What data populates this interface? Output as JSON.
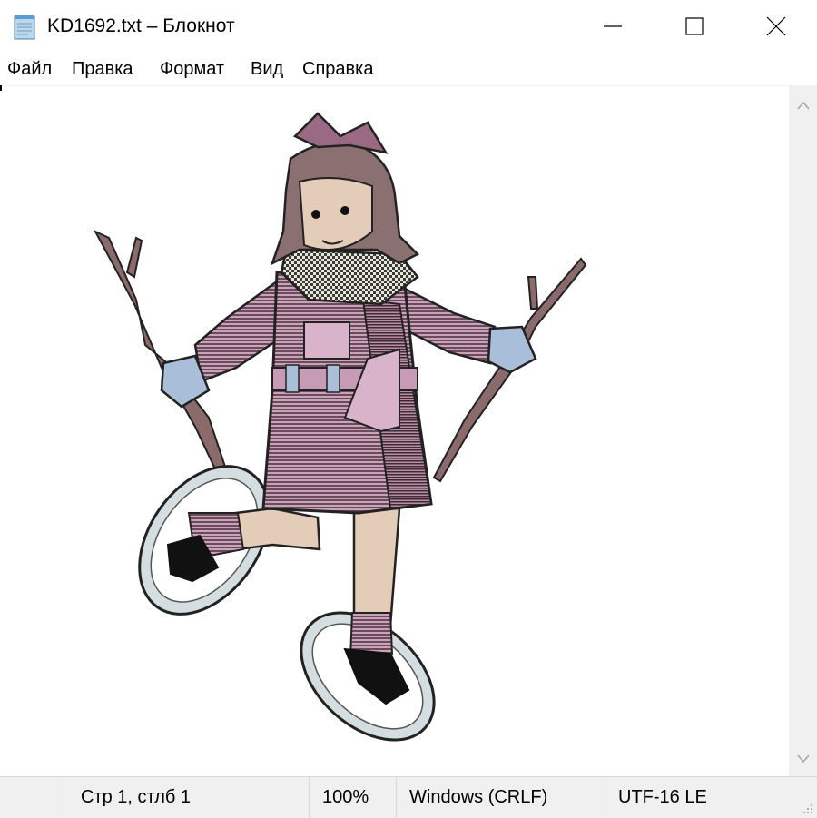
{
  "window": {
    "title": "KD1692.txt – Блокнот",
    "icon": "notepad-icon",
    "controls": [
      "minimize-icon",
      "maximize-icon",
      "close-icon"
    ]
  },
  "menu": {
    "items": [
      "Файл",
      "Правка",
      "Формат",
      "Вид",
      "Справка"
    ]
  },
  "editor": {
    "content_description_icon": "ascii-art-girl-on-snowshoes",
    "scrollbar": {
      "up_icon": "chevron-up-icon",
      "down_icon": "chevron-down-icon"
    }
  },
  "statusbar": {
    "position": "Стр 1, стлб 1",
    "zoom": "100%",
    "line_endings": "Windows (CRLF)",
    "encoding": "UTF-16 LE"
  },
  "colors": {
    "coat_pink": "#c9a3b8",
    "coat_dark": "#5a3a4c",
    "hair_brown": "#8a7070",
    "skin": "#e3cdb8",
    "mitten_blue": "#a9bfd9",
    "snowshoe_grey": "#d4dde0",
    "stick_brown": "#8a6a6a",
    "statusbar_bg": "#f0f0f0"
  }
}
